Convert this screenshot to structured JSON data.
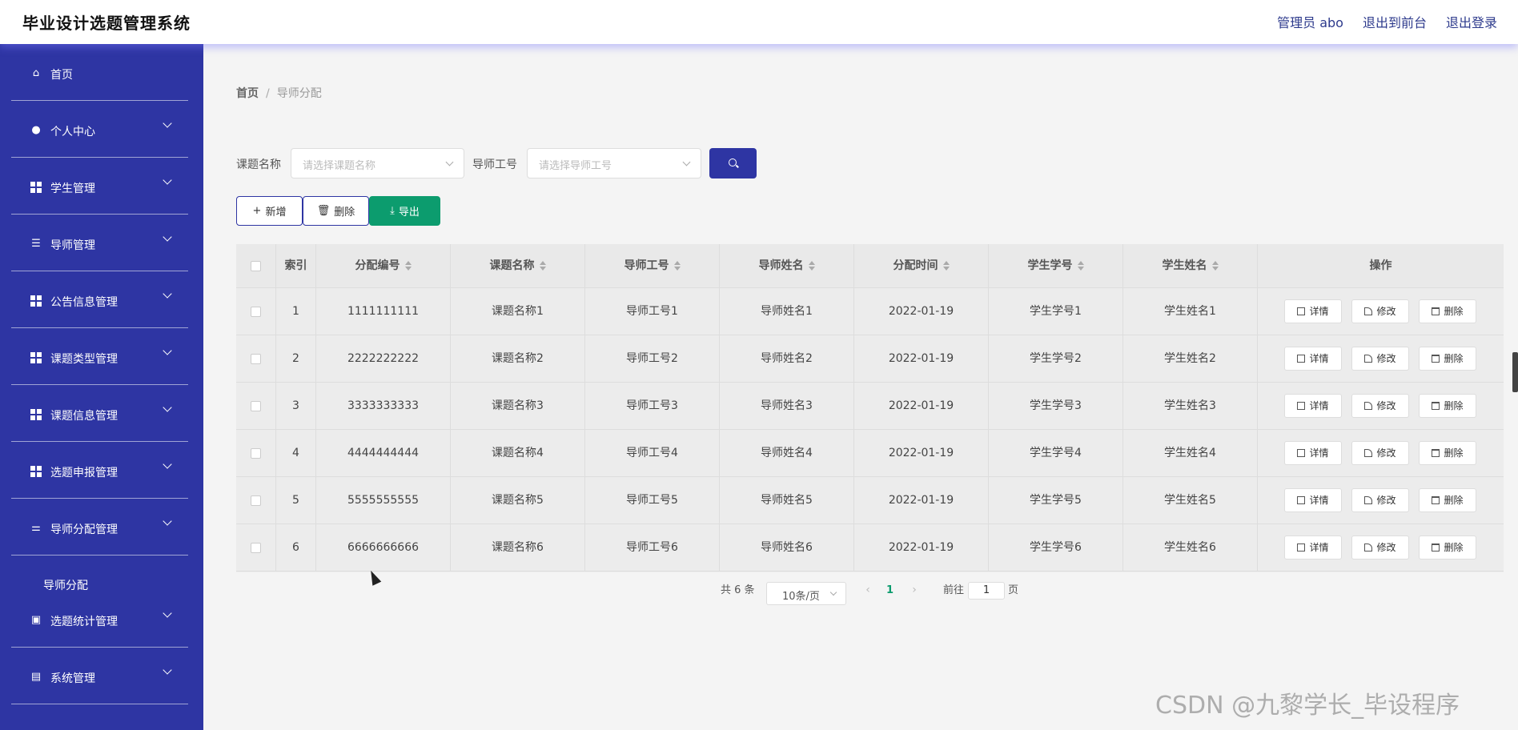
{
  "header": {
    "title": "毕业设计选题管理系统",
    "admin": "管理员 abo",
    "to_front": "退出到前台",
    "logout": "退出登录"
  },
  "sidebar": {
    "items": [
      {
        "label": "首页",
        "icon": "home-icon"
      },
      {
        "label": "个人中心",
        "icon": "user-icon"
      },
      {
        "label": "学生管理",
        "icon": "grid-icon"
      },
      {
        "label": "导师管理",
        "icon": "list-icon"
      },
      {
        "label": "公告信息管理",
        "icon": "grid-icon"
      },
      {
        "label": "课题类型管理",
        "icon": "grid-icon"
      },
      {
        "label": "课题信息管理",
        "icon": "grid-icon"
      },
      {
        "label": "选题申报管理",
        "icon": "grid-icon"
      },
      {
        "label": "导师分配管理",
        "icon": "sliders-icon"
      },
      {
        "label": "选题统计管理",
        "icon": "clipboard-icon"
      },
      {
        "label": "系统管理",
        "icon": "chart-icon"
      }
    ],
    "sub_item": "导师分配"
  },
  "breadcrumb": {
    "home": "首页",
    "sep": "/",
    "current": "导师分配"
  },
  "filters": {
    "topic_label": "课题名称",
    "topic_placeholder": "请选择课题名称",
    "teacher_label": "导师工号",
    "teacher_placeholder": "请选择导师工号"
  },
  "actions": {
    "add": "新增",
    "delete": "删除",
    "export": "导出"
  },
  "table": {
    "headers": [
      "索引",
      "分配编号",
      "课题名称",
      "导师工号",
      "导师姓名",
      "分配时间",
      "学生学号",
      "学生姓名",
      "操作"
    ],
    "rows": [
      [
        "1",
        "1111111111",
        "课题名称1",
        "导师工号1",
        "导师姓名1",
        "2022-01-19",
        "学生学号1",
        "学生姓名1"
      ],
      [
        "2",
        "2222222222",
        "课题名称2",
        "导师工号2",
        "导师姓名2",
        "2022-01-19",
        "学生学号2",
        "学生姓名2"
      ],
      [
        "3",
        "3333333333",
        "课题名称3",
        "导师工号3",
        "导师姓名3",
        "2022-01-19",
        "学生学号3",
        "学生姓名3"
      ],
      [
        "4",
        "4444444444",
        "课题名称4",
        "导师工号4",
        "导师姓名4",
        "2022-01-19",
        "学生学号4",
        "学生姓名4"
      ],
      [
        "5",
        "5555555555",
        "课题名称5",
        "导师工号5",
        "导师姓名5",
        "2022-01-19",
        "学生学号5",
        "学生姓名5"
      ],
      [
        "6",
        "6666666666",
        "课题名称6",
        "导师工号6",
        "导师姓名6",
        "2022-01-19",
        "学生学号6",
        "学生姓名6"
      ]
    ],
    "row_actions": {
      "detail": "详情",
      "edit": "修改",
      "delete": "删除"
    }
  },
  "pagination": {
    "total": "共 6 条",
    "page_size": "10条/页",
    "current_page": "1",
    "goto_label": "前往",
    "goto_value": "1",
    "page_suffix": "页"
  },
  "watermark": "CSDN @九黎学长_毕设程序",
  "colors": {
    "primary": "#2e35a3",
    "success": "#0c9c6e"
  }
}
